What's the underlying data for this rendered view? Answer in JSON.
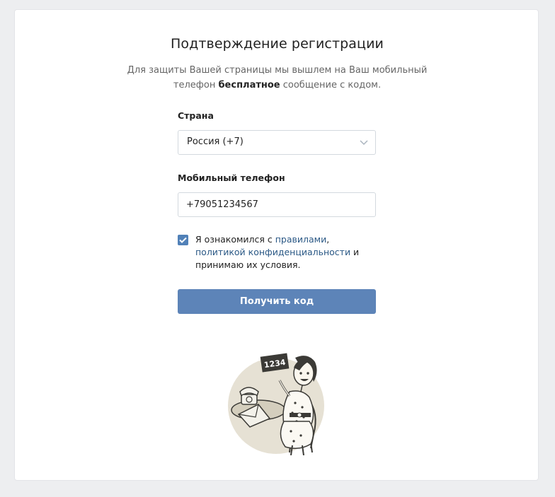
{
  "page": {
    "title": "Подтверждение регистрации",
    "description_part1": "Для защиты Вашей страницы мы вышлем на Ваш мобильный телефон ",
    "description_bold": "бесплатное",
    "description_part2": " сообщение с кодом."
  },
  "country": {
    "label": "Страна",
    "selected": "Россия (+7)"
  },
  "phone": {
    "label": "Мобильный телефон",
    "value": "+79051234567"
  },
  "agreement": {
    "checked": true,
    "text_1": "Я ознакомился с ",
    "rules_link": "правилами",
    "text_2": ", ",
    "text_3": "политикой ",
    "privacy_link": "конфиденциальности",
    "text_4": " и принимаю их условия."
  },
  "submit": {
    "label": "Получить код"
  },
  "illustration": {
    "sign_text": "1234"
  },
  "colors": {
    "background": "#edeef0",
    "accent": "#5181b8",
    "button": "#5d84b8",
    "link": "#2a5885"
  }
}
